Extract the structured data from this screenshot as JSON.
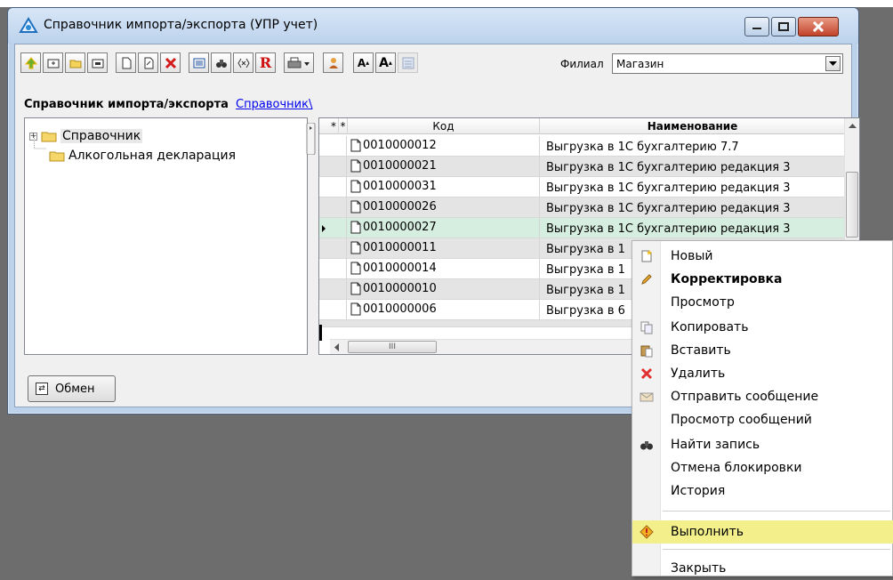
{
  "window": {
    "title": "Справочник импорта/экспорта (УПР учет)"
  },
  "toolbar": {
    "filial_label": "Филиал",
    "filial_value": "Магазин",
    "r_glyph": "R",
    "font_up": "A",
    "font_down": "A"
  },
  "breadcrumb": {
    "title": "Справочник импорта/экспорта",
    "link": "Справочник\\"
  },
  "tree": {
    "items": [
      {
        "label": "Справочник",
        "expander": "+"
      },
      {
        "label": "Алкогольная декларация"
      }
    ]
  },
  "grid": {
    "columns": {
      "mark1": "*",
      "mark2": "*",
      "code": "Код",
      "name": "Наименование"
    },
    "rows": [
      {
        "code": "0010000012",
        "name": "Выгрузка  в 1С бухгалтерию 7.7"
      },
      {
        "code": "0010000021",
        "name": "Выгрузка  в 1С бухгалтерию редакция 3"
      },
      {
        "code": "0010000031",
        "name": "Выгрузка  в 1С бухгалтерию редакция 3"
      },
      {
        "code": "0010000026",
        "name": "Выгрузка  в 1С бухгалтерию редакция 3"
      },
      {
        "code": "0010000027",
        "name": "Выгрузка  в 1С бухгалтерию редакция 3"
      },
      {
        "code": "0010000011",
        "name": "Выгрузка  в 1"
      },
      {
        "code": "0010000014",
        "name": "Выгрузка  в 1"
      },
      {
        "code": "0010000010",
        "name": "Выгрузка  в 1"
      },
      {
        "code": "0010000006",
        "name": "Выгрузка  в 6"
      }
    ],
    "hscroll_grip": "III"
  },
  "bottom": {
    "exchange_label": "Обмен"
  },
  "context_menu": {
    "items": [
      {
        "label": "Новый",
        "icon": "new-icon"
      },
      {
        "label": "Корректировка",
        "icon": "pencil-icon"
      },
      {
        "label": "Просмотр",
        "icon": ""
      },
      {
        "label": "Копировать",
        "icon": "copy-icon"
      },
      {
        "label": "Вставить",
        "icon": "paste-icon"
      },
      {
        "label": "Удалить",
        "icon": "delete-icon"
      },
      {
        "label": "Отправить сообщение",
        "icon": "envelope-icon"
      },
      {
        "label": "Просмотр сообщений",
        "icon": ""
      },
      {
        "label": "Найти запись",
        "icon": "binoculars-icon"
      },
      {
        "label": "Отмена блокировки",
        "icon": ""
      },
      {
        "label": "История",
        "icon": ""
      },
      {
        "label": "Выполнить",
        "icon": "execute-icon"
      },
      {
        "label": "Закрыть",
        "icon": ""
      }
    ]
  },
  "colors": {
    "current_row": "#d6eee0",
    "menu_highlight": "#f3f08b",
    "link": "#0000ee",
    "close_button": "#c2432a"
  }
}
